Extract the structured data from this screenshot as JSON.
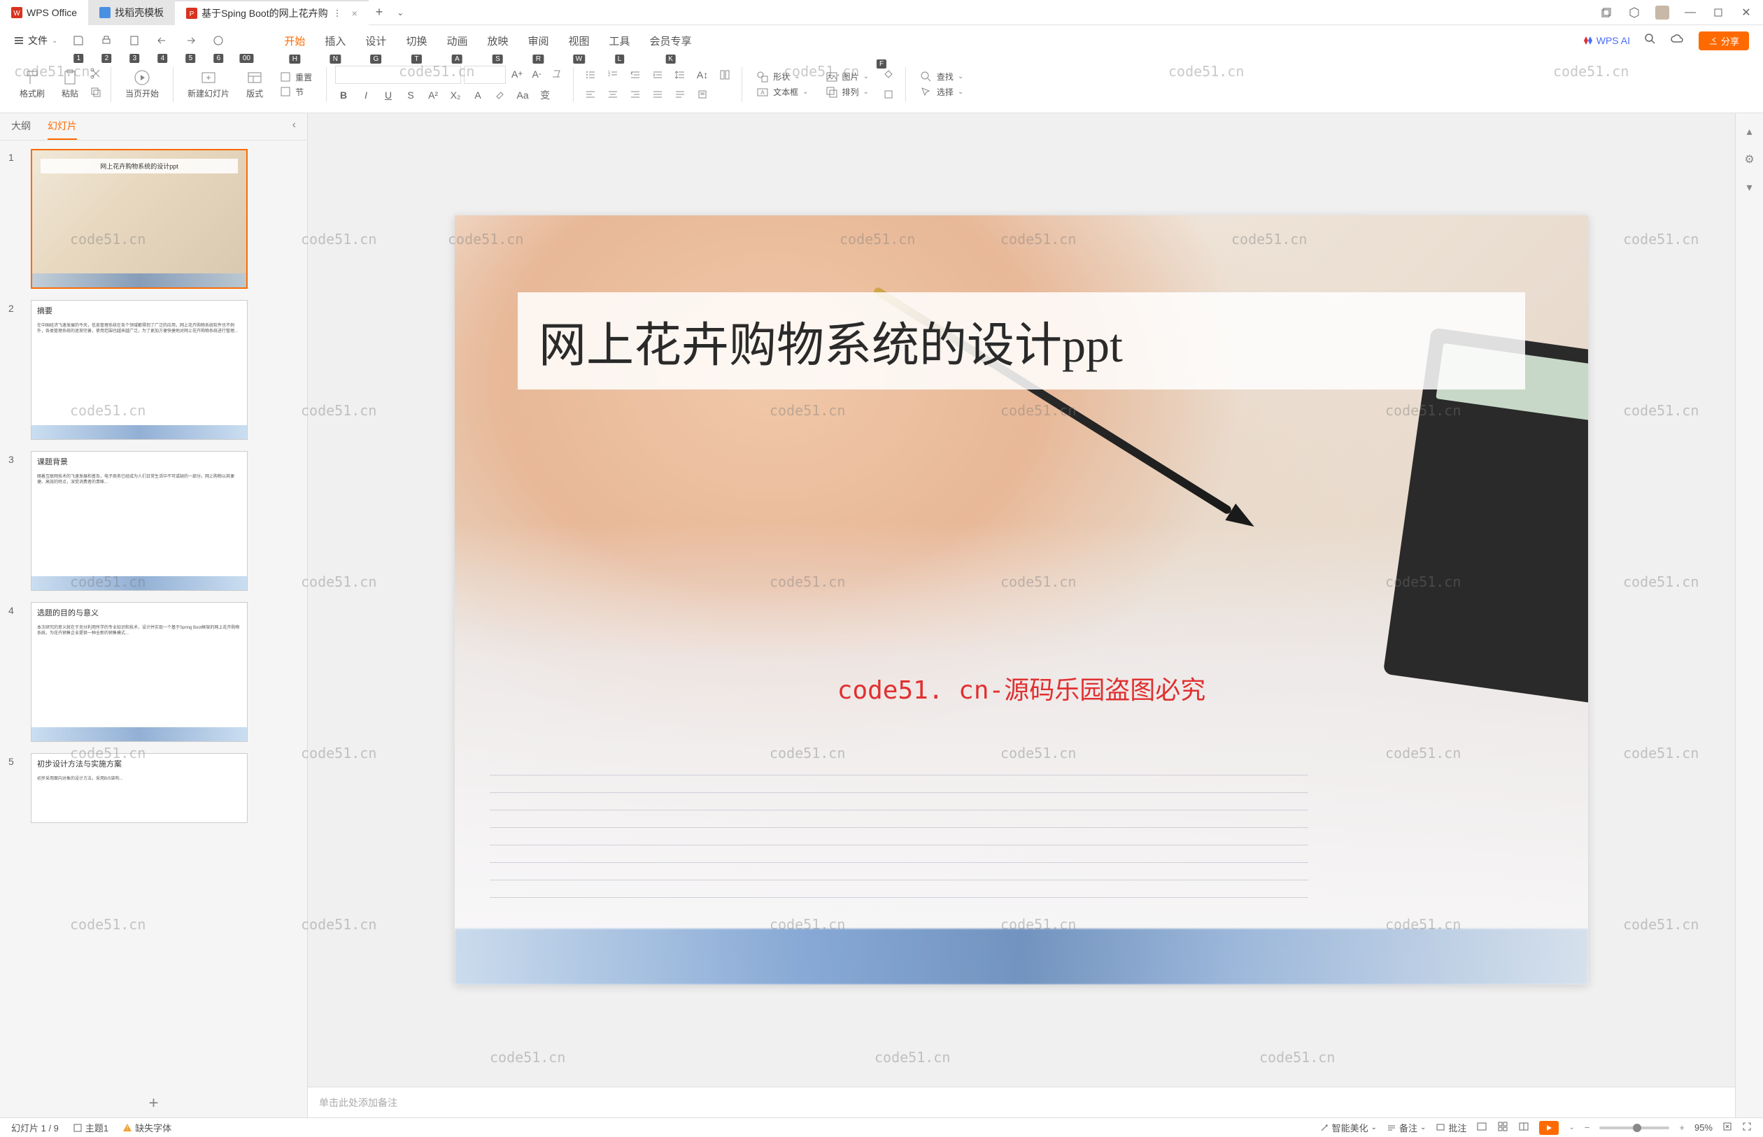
{
  "titlebar": {
    "tabs": [
      {
        "label": "WPS Office",
        "icon": "wps"
      },
      {
        "label": "找稻壳模板",
        "icon": "template"
      },
      {
        "label": "基于Sping Boot的网上花卉购",
        "icon": "ppt",
        "active": true
      }
    ]
  },
  "menubar": {
    "file": "文件",
    "key_F": "F",
    "quick_keys": [
      "1",
      "2",
      "3",
      "4",
      "5",
      "6",
      "00"
    ],
    "tabs": [
      {
        "label": "开始",
        "key": "H",
        "active": true
      },
      {
        "label": "插入",
        "key": "N"
      },
      {
        "label": "设计",
        "key": "G"
      },
      {
        "label": "切换",
        "key": "T"
      },
      {
        "label": "动画",
        "key": "A"
      },
      {
        "label": "放映",
        "key": "S"
      },
      {
        "label": "审阅",
        "key": "R"
      },
      {
        "label": "视图",
        "key": "W"
      },
      {
        "label": "工具",
        "key": "L"
      },
      {
        "label": "会员专享",
        "key": "K"
      }
    ],
    "wps_ai": "WPS AI",
    "share": "分享"
  },
  "ribbon": {
    "format_brush": "格式刷",
    "paste": "粘贴",
    "from_current": "当页开始",
    "new_slide": "新建幻灯片",
    "layout": "版式",
    "section": "节",
    "reset": "重置",
    "shape": "形状",
    "image": "图片",
    "textbox": "文本框",
    "arrange": "排列",
    "find": "查找",
    "select": "选择"
  },
  "sidebar": {
    "tab_outline": "大纲",
    "tab_slides": "幻灯片",
    "thumbs": [
      {
        "num": "1",
        "title": "网上花卉购物系统的设计ppt"
      },
      {
        "num": "2",
        "title": "摘要"
      },
      {
        "num": "3",
        "title": "课题背景"
      },
      {
        "num": "4",
        "title": "选题的目的与意义"
      },
      {
        "num": "5",
        "title": "初步设计方法与实施方案"
      }
    ]
  },
  "slide": {
    "title": "网上花卉购物系统的设计ppt",
    "watermark": "code51. cn-源码乐园盗图必究"
  },
  "notes": "单击此处添加备注",
  "statusbar": {
    "slide_count": "幻灯片 1 / 9",
    "theme": "主题1",
    "missing_font": "缺失字体",
    "beautify": "智能美化",
    "notes": "备注",
    "comments": "批注",
    "zoom": "95%"
  },
  "wm": "code51.cn"
}
